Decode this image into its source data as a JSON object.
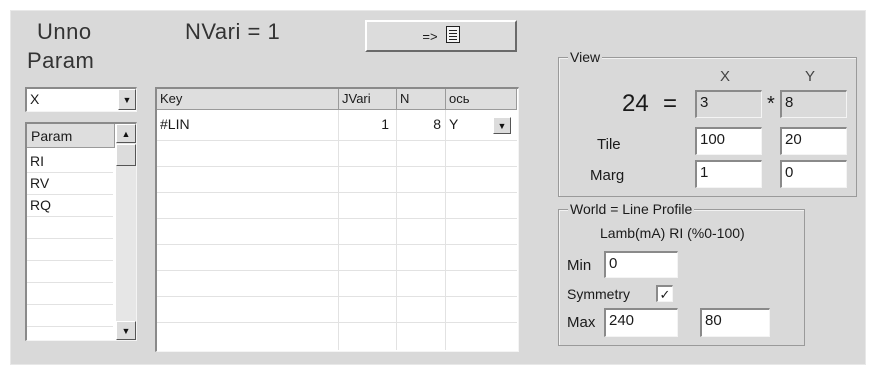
{
  "header": {
    "title_line1": "Unno",
    "title_line2": "Param",
    "nvari_text": "NVari = 1",
    "arrow_button_label": "=>",
    "list_icon": "list-document-icon"
  },
  "left_panel": {
    "axis_select_value": "X",
    "param_list_header": "Param",
    "param_items": [
      "RI",
      "RV",
      "RQ"
    ]
  },
  "table": {
    "columns": [
      "Key",
      "JVari",
      "N",
      "ось"
    ],
    "rows": [
      {
        "key": "#LIN",
        "jvari": "1",
        "n": "8",
        "axis": "Y"
      }
    ]
  },
  "view": {
    "legend": "View",
    "x_header": "X",
    "y_header": "Y",
    "total": "24",
    "equals": "=",
    "times": "*",
    "x_value": "3",
    "y_value": "8",
    "tile_label": "Tile",
    "tile_x": "100",
    "tile_y": "20",
    "marg_label": "Marg",
    "marg_x": "1",
    "marg_y": "0"
  },
  "world": {
    "legend": "World = Line Profile",
    "subtitle": "Lamb(mA) RI (%0-100)",
    "min_label": "Min",
    "min_value": "0",
    "symmetry_label": "Symmetry",
    "symmetry_checked": true,
    "check_mark": "✓",
    "max_label": "Max",
    "max_value": "240",
    "max_value2": "80"
  },
  "glyphs": {
    "down_arrow": "▼",
    "up_arrow": "▲"
  }
}
